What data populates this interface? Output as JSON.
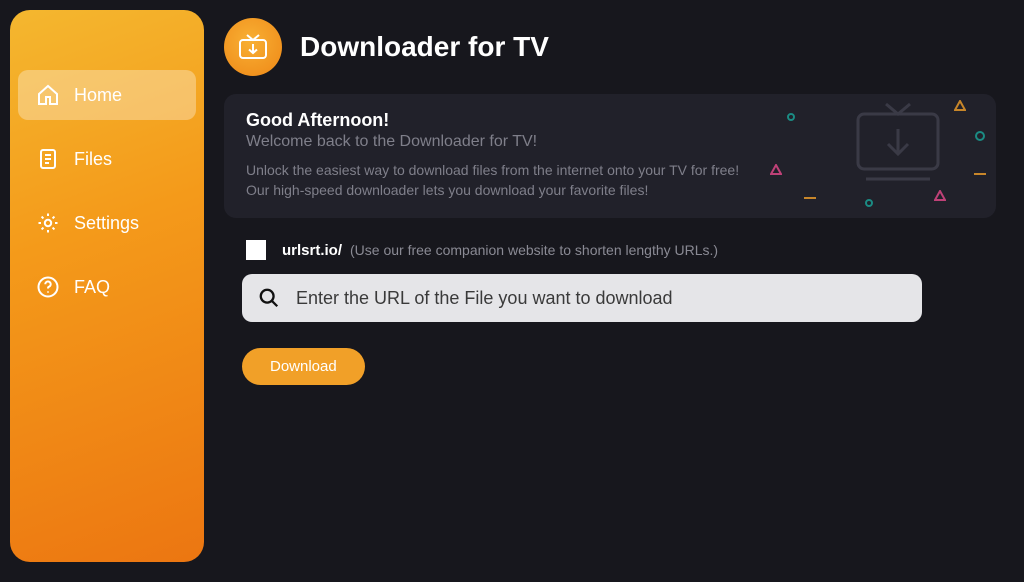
{
  "app_title": "Downloader for TV",
  "sidebar": {
    "items": [
      {
        "label": "Home",
        "icon": "home-icon",
        "active": true
      },
      {
        "label": "Files",
        "icon": "files-icon",
        "active": false
      },
      {
        "label": "Settings",
        "icon": "settings-icon",
        "active": false
      },
      {
        "label": "FAQ",
        "icon": "faq-icon",
        "active": false
      }
    ]
  },
  "welcome": {
    "greeting": "Good Afternoon!",
    "subheading": "Welcome back to the Downloader for TV!",
    "description": "Unlock the easiest way to download files from the internet onto your TV for free! Our high-speed downloader lets you download your favorite files!"
  },
  "shortener": {
    "checkbox_checked": false,
    "label": "urlsrt.io/",
    "hint": "(Use our free companion website to shorten lengthy URLs.)"
  },
  "url_input": {
    "placeholder": "Enter the URL of the File you want to download",
    "value": ""
  },
  "download_button_label": "Download",
  "colors": {
    "accent": "#f1a028",
    "background": "#17171d",
    "card": "#21212a",
    "deco_green": "#1aa69a",
    "deco_pink": "#e74a8b",
    "deco_orange": "#f2a02a"
  }
}
